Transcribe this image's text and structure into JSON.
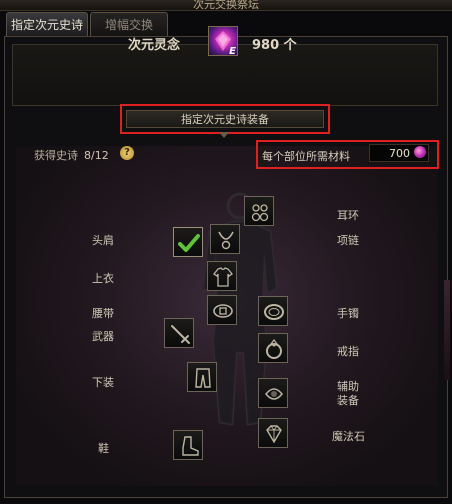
{
  "window": {
    "title": "次元交换祭坛"
  },
  "tabs": [
    {
      "label": "指定次元史诗",
      "active": true
    },
    {
      "label": "增幅交换",
      "active": false
    }
  ],
  "header": {
    "currency_label": "次元灵念",
    "currency_count": "980 个",
    "item_badge": "E"
  },
  "sub_tab": {
    "label": "指定次元史诗装备"
  },
  "obtained": {
    "label": "获得史诗",
    "count": "8/12",
    "help": "?"
  },
  "per_part": {
    "label": "每个部位所需材料",
    "value": "700"
  },
  "slots": {
    "left": [
      {
        "label": "头肩",
        "checked": true
      },
      {
        "label": "上衣",
        "checked": false
      },
      {
        "label": "腰带",
        "checked": false
      },
      {
        "label": "武器",
        "checked": false
      },
      {
        "label": "下装",
        "checked": false
      },
      {
        "label": "鞋",
        "checked": false
      }
    ],
    "right": [
      {
        "label": "耳环",
        "checked": false
      },
      {
        "label": "项链",
        "checked": false
      },
      {
        "label": "手镯",
        "checked": false
      },
      {
        "label": "戒指",
        "checked": false
      },
      {
        "label": "辅助",
        "label2": "装备",
        "checked": false
      },
      {
        "label": "魔法石",
        "checked": false
      }
    ]
  },
  "colors": {
    "highlight_border": "#e02020",
    "check": "#5ec23a",
    "text": "#cfc8b6"
  }
}
